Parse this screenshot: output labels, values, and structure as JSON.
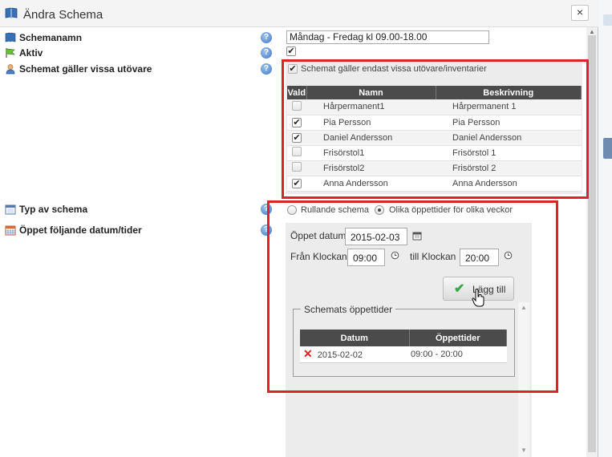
{
  "dialog": {
    "title": "Ändra  Schema",
    "close_glyph": "×"
  },
  "fields": {
    "schedule_name_label": "Schemanamn",
    "schedule_name_value": "Måndag - Fredag kl 09.00-18.00",
    "active_label": "Aktiv",
    "active_checked": true,
    "applies_label": "Schemat gäller vissa utövare",
    "type_label": "Typ av schema",
    "open_dates_label": "Öppet följande datum/tider",
    "help_glyph": "?"
  },
  "restriction": {
    "checkbox_label": "Schemat gäller endast vissa utövare/inventarier",
    "checked": true,
    "columns": [
      "Vald",
      "Namn",
      "Beskrivning"
    ],
    "rows": [
      {
        "selected": false,
        "name": "Hårpermanent1",
        "description": "Hårpermanent 1"
      },
      {
        "selected": true,
        "name": "Pia Persson",
        "description": "Pia Persson"
      },
      {
        "selected": true,
        "name": "Daniel Andersson",
        "description": "Daniel Andersson"
      },
      {
        "selected": false,
        "name": "Frisörstol1",
        "description": "Frisörstol 1"
      },
      {
        "selected": false,
        "name": "Frisörstol2",
        "description": "Frisörstol 2"
      },
      {
        "selected": true,
        "name": "Anna Andersson",
        "description": "Anna Andersson"
      }
    ]
  },
  "schedule_type": {
    "options": [
      "Rullande schema",
      "Olika öppettider för olika veckor"
    ],
    "selected_index": 1
  },
  "open_times": {
    "date_label": "Öppet datum",
    "date_value": "2015-02-03",
    "from_label": "Från Klockan",
    "from_value": "09:00",
    "to_label": "till Klockan",
    "to_value": "20:00",
    "add_button": "Lägg till"
  },
  "schedule_times": {
    "legend": "Schemats öppettider",
    "columns": [
      "Datum",
      "Öppettider"
    ],
    "rows": [
      {
        "date": "2015-02-02",
        "hours": "09:00 - 20:00"
      }
    ]
  }
}
